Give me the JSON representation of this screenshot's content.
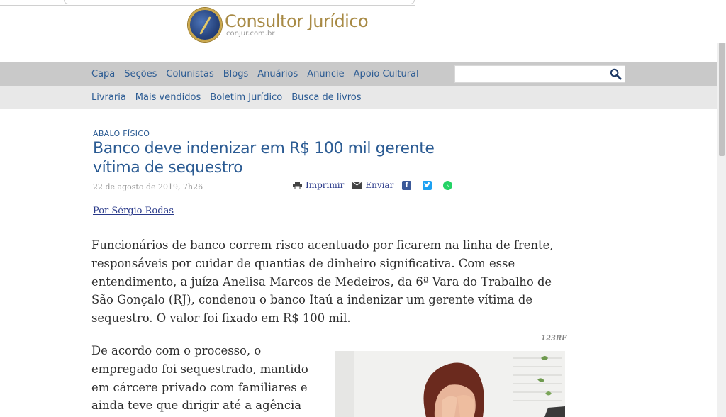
{
  "logo": {
    "name": "Consultor Jurídico",
    "domain": "conjur.com.br"
  },
  "nav_primary": [
    "Capa",
    "Seções",
    "Colunistas",
    "Blogs",
    "Anuários",
    "Anuncie",
    "Apoio Cultural"
  ],
  "nav_secondary": [
    "Livraria",
    "Mais vendidos",
    "Boletim Jurídico",
    "Busca de livros"
  ],
  "search": {
    "value": "",
    "icon": "search-icon"
  },
  "article": {
    "kicker": "ABALO FÍSICO",
    "headline": "Banco deve indenizar em R$ 100 mil gerente vítima de sequestro",
    "date": "22 de agosto de 2019, 7h26",
    "tools": {
      "print": "Imprimir",
      "send": "Enviar"
    },
    "author": "Por Sérgio Rodas",
    "paragraph1": "Funcionários de banco correm risco acentuado por ficarem na linha de frente, responsáveis por cuidar de quantias de dinheiro significativa. Com esse entendimento, a juíza Anelisa Marcos de Medeiros, da 6ª Vara do Trabalho de São Gonçalo (RJ), condenou o banco Itaú a indenizar um gerente vítima de sequestro. O valor foi fixado em R$ 100 mil.",
    "paragraph2": "De acordo com o processo, o empregado foi sequestrado, mantido em cárcere privado com familiares e ainda teve que dirigir até a agência",
    "photo_credit": "123RF"
  },
  "colors": {
    "link_blue": "#2b5b93",
    "nav_bar": "#c9c9c9",
    "nav_bar_light": "#e8e8e8",
    "logo_gold": "#a88a45"
  }
}
